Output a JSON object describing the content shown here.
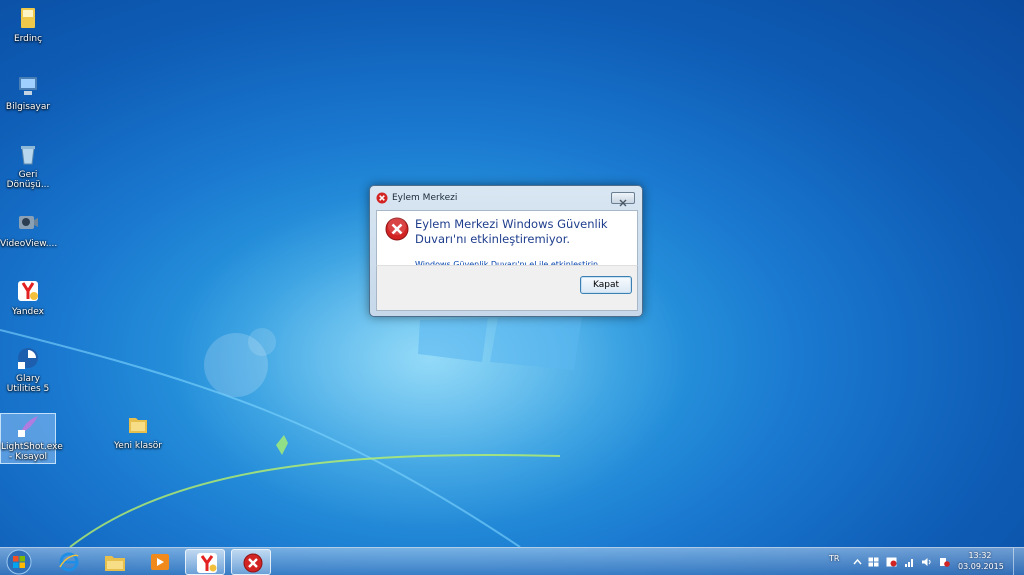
{
  "desktop": {
    "icons": [
      {
        "label": "Erdinç",
        "icon": "user-folder-icon"
      },
      {
        "label": "Bilgisayar",
        "icon": "computer-icon"
      },
      {
        "label": "Geri Dönüşü...",
        "icon": "recycle-bin-icon"
      },
      {
        "label": "VideoView....",
        "icon": "video-app-icon"
      },
      {
        "label": "Yandex",
        "icon": "yandex-browser-icon"
      },
      {
        "label": "Glary Utilities 5",
        "icon": "glary-utilities-icon"
      },
      {
        "label": "LightShot.exe - Kısayol",
        "icon": "lightshot-icon"
      },
      {
        "label": "Yeni klasör",
        "icon": "folder-icon"
      }
    ]
  },
  "dialog": {
    "title": "Eylem Merkezi",
    "message": "Eylem Merkezi Windows Güvenlik Duvarı'nı etkinleştiremiyor.",
    "link": "Windows Güvenlik Duvarı'nı el ile etkinleştirin",
    "button": "Kapat"
  },
  "taskbar": {
    "apps": [
      "internet-explorer-icon",
      "file-explorer-icon",
      "media-player-icon",
      "yandex-browser-icon",
      "error-icon"
    ],
    "tray": {
      "language": "TR",
      "time": "13:32",
      "date": "03.09.2015"
    }
  },
  "colors": {
    "desktop_blue": "#1a78cf",
    "dialog_text": "#1e3d8c",
    "link": "#0645ad",
    "error_red": "#d32424"
  }
}
